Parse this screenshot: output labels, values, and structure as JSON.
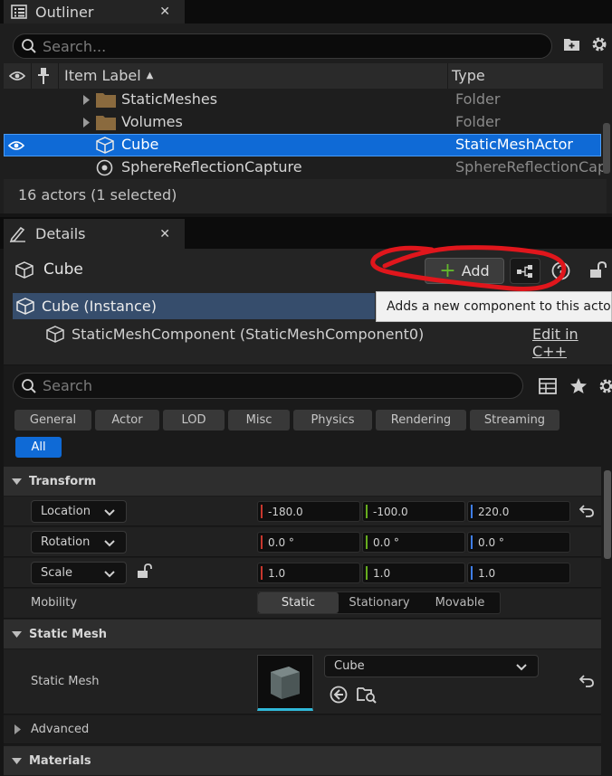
{
  "outliner": {
    "tab_label": "Outliner",
    "close_glyph": "✕",
    "search_placeholder": "Search...",
    "columns": {
      "label": "Item Label",
      "sort_indicator": "▲",
      "type": "Type"
    },
    "rows": [
      {
        "label": "StaticMeshes",
        "type": "Folder",
        "icon": "folder-icon"
      },
      {
        "label": "Volumes",
        "type": "Folder",
        "icon": "folder-icon"
      },
      {
        "label": "Cube",
        "type": "StaticMeshActor",
        "icon": "static-mesh-actor-icon",
        "selected": true
      },
      {
        "label": "SphereReflectionCapture",
        "type": "SphereReflectionCap",
        "icon": "reflection-capture-icon"
      }
    ],
    "status": "16 actors (1 selected)"
  },
  "details": {
    "tab_label": "Details",
    "close_glyph": "✕",
    "actor_name": "Cube",
    "add_button": {
      "plus": "+",
      "label": "Add"
    },
    "tooltip": "Adds a new component to this actor",
    "components": [
      {
        "label": "Cube (Instance)",
        "selected": true
      },
      {
        "label": "StaticMeshComponent (StaticMeshComponent0)"
      }
    ],
    "edit_cpp_link": "Edit in C++",
    "search_placeholder": "Search",
    "categories": [
      "General",
      "Actor",
      "LOD",
      "Misc",
      "Physics",
      "Rendering",
      "Streaming",
      "All"
    ],
    "active_category": "All",
    "sections": {
      "transform": "Transform",
      "static_mesh": "Static Mesh",
      "advanced": "Advanced",
      "materials": "Materials"
    },
    "transform": {
      "location": {
        "label": "Location",
        "x": "-180.0",
        "y": "-100.0",
        "z": "220.0"
      },
      "rotation": {
        "label": "Rotation",
        "x": "0.0 °",
        "y": "0.0 °",
        "z": "0.0 °"
      },
      "scale": {
        "label": "Scale",
        "x": "1.0",
        "y": "1.0",
        "z": "1.0"
      },
      "mobility": {
        "label": "Mobility",
        "options": [
          "Static",
          "Stationary",
          "Movable"
        ],
        "selected": "Static"
      }
    },
    "static_mesh": {
      "label": "Static Mesh",
      "value": "Cube"
    },
    "colors": {
      "x_axis": "#c8372d",
      "y_axis": "#67ad1e",
      "z_axis": "#3f7ee8",
      "selection": "#0f6ad6",
      "annotation": "#e0161c"
    }
  }
}
